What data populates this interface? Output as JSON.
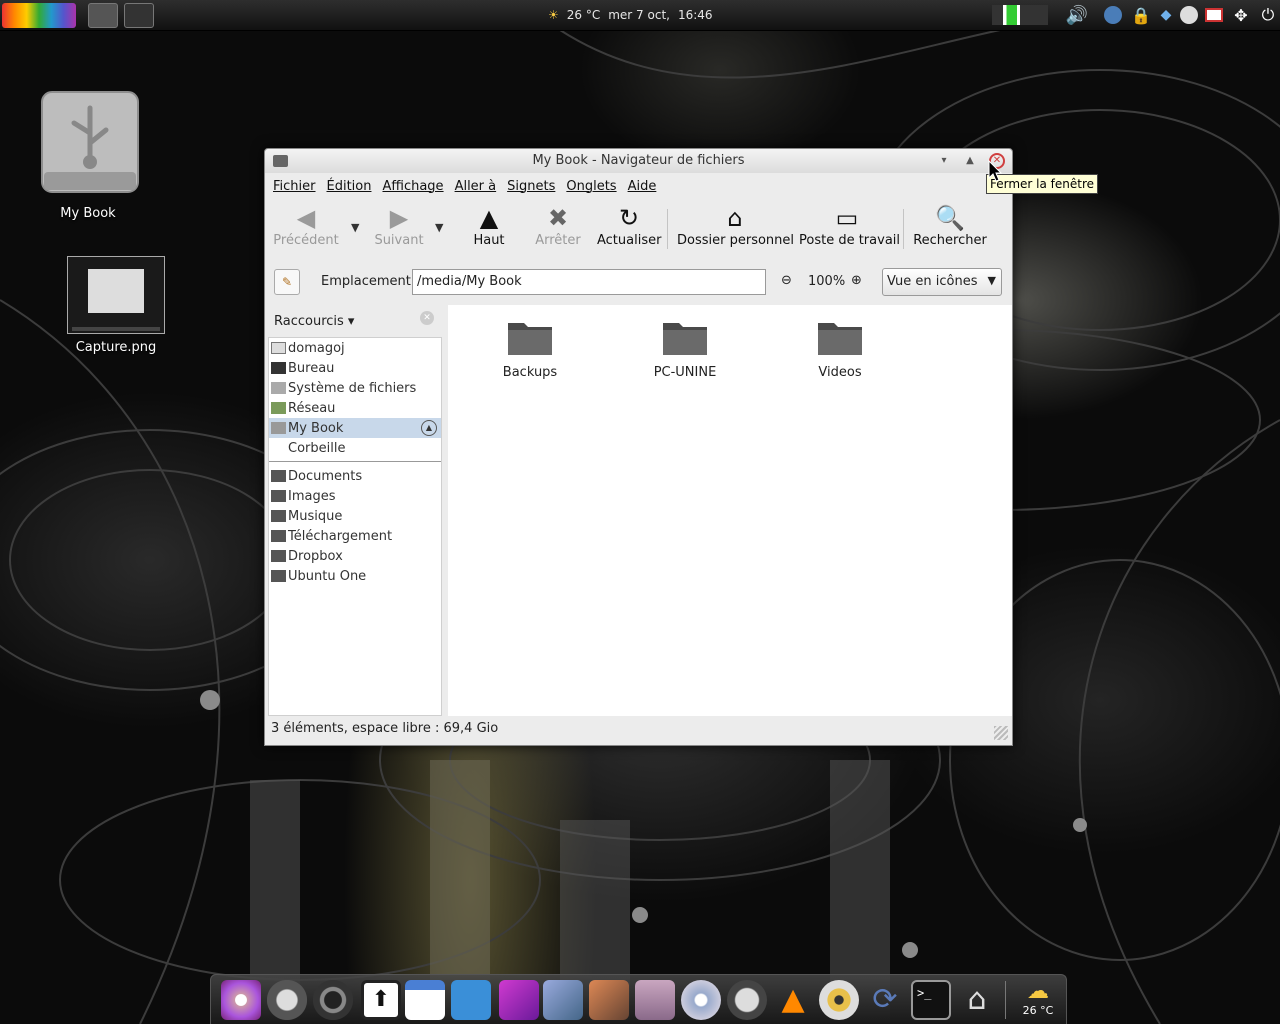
{
  "top_panel": {
    "weather": "26 °C",
    "date": "mer  7 oct,",
    "time": "16:46"
  },
  "desktop": {
    "icons": [
      {
        "label": "My Book",
        "icon": "external-drive-icon"
      },
      {
        "label": "Capture.png",
        "icon": "image-thumbnail-icon"
      }
    ]
  },
  "window": {
    "title": "My Book - Navigateur de fichiers",
    "menu": [
      "Fichier",
      "Édition",
      "Affichage",
      "Aller à",
      "Signets",
      "Onglets",
      "Aide"
    ],
    "toolbar": {
      "back": "Précédent",
      "forward": "Suivant",
      "up": "Haut",
      "stop": "Arrêter",
      "reload": "Actualiser",
      "home": "Dossier personnel",
      "computer": "Poste de travail",
      "search": "Rechercher"
    },
    "location": {
      "label": "Emplacement :",
      "value": "/media/My Book",
      "zoom": "100%",
      "view_mode": "Vue en icônes"
    },
    "sidebar": {
      "header": "Raccourcis",
      "places": [
        {
          "label": "domagoj",
          "icon": "home-icon"
        },
        {
          "label": "Bureau",
          "icon": "desktop-icon"
        },
        {
          "label": "Système de fichiers",
          "icon": "harddisk-icon"
        },
        {
          "label": "Réseau",
          "icon": "network-icon"
        },
        {
          "label": "My Book",
          "icon": "drive-icon",
          "selected": true
        },
        {
          "label": "Corbeille",
          "icon": ""
        }
      ],
      "bookmarks": [
        {
          "label": "Documents",
          "icon": "folder-icon"
        },
        {
          "label": "Images",
          "icon": "folder-icon"
        },
        {
          "label": "Musique",
          "icon": "folder-icon"
        },
        {
          "label": "Téléchargement",
          "icon": "folder-icon"
        },
        {
          "label": "Dropbox",
          "icon": "folder-icon"
        },
        {
          "label": "Ubuntu One",
          "icon": "folder-icon"
        }
      ]
    },
    "files": [
      {
        "name": "Backups",
        "icon": "folder-icon"
      },
      {
        "name": "PC-UNINE",
        "icon": "folder-icon"
      },
      {
        "name": "Videos",
        "icon": "folder-icon"
      }
    ],
    "status": "3 éléments, espace libre : 69,4 Gio",
    "close_tooltip": "Fermer la fenêtre"
  },
  "dock": {
    "weather_label": "26 °C",
    "apps": [
      "settings-icon",
      "firefox-icon",
      "chrome-icon",
      "upload-icon",
      "calendar-icon",
      "messenger-icon",
      "graphics-icon",
      "photos-icon",
      "gallery-icon",
      "media-player-icon",
      "itunes-icon",
      "headphones-icon",
      "vlc-icon",
      "disc-burner-icon",
      "sync-icon",
      "terminal-icon",
      "home-folder-icon"
    ]
  }
}
